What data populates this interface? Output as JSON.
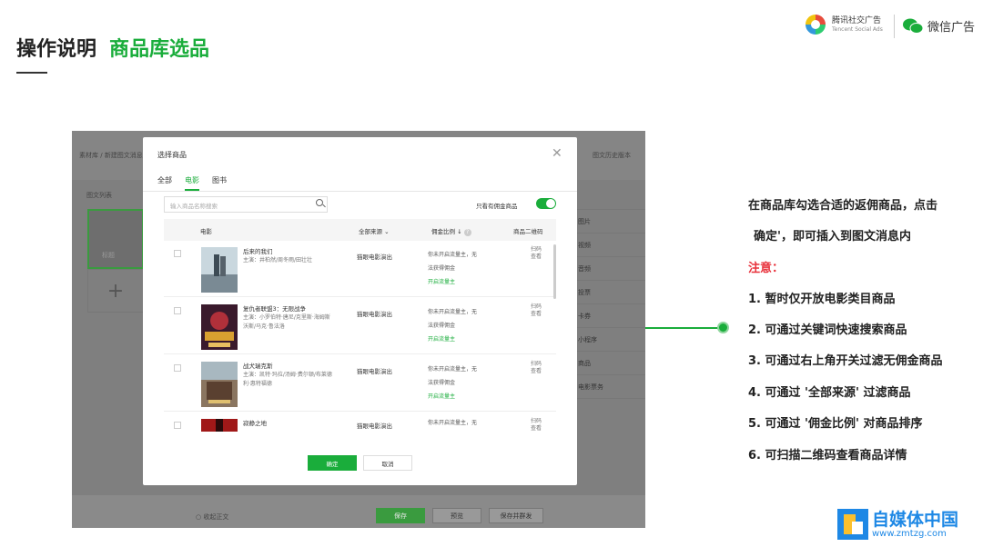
{
  "header": {
    "title": "操作说明",
    "subtitle": "商品库选品"
  },
  "logos": {
    "tencent_cn": "腾讯社交广告",
    "tencent_en": "Tencent Social Ads",
    "wechat": "微信广告"
  },
  "bg_screen": {
    "breadcrumb1": "素材库",
    "breadcrumb2": "新建图文消息",
    "history": "图文历史版本",
    "list_label": "图文列表",
    "card_label": "标题",
    "side_items": [
      "图片",
      "视频",
      "音频",
      "投票",
      "卡券",
      "小程序",
      "商品",
      "电影票务"
    ],
    "collapse": "收起正文",
    "btn_save": "保存",
    "btn_preview": "预览",
    "btn_save_send": "保存并群发"
  },
  "modal": {
    "title": "选择商品",
    "tabs": [
      "全部",
      "电影",
      "图书"
    ],
    "search_placeholder": "输入商品名称搜索",
    "filter_label": "只看有佣金商品",
    "columns": {
      "movie": "电影",
      "source": "全部来源",
      "commission": "佣金比例",
      "qr": "商品二维码"
    },
    "rows": [
      {
        "name": "后来的我们",
        "cast": "主演：井柏然/周冬雨/田壮壮",
        "source": "猫眼电影演出",
        "comm1": "你未开启流量主，无",
        "comm2": "法获得佣金",
        "comm_link": "开启流量主",
        "qr": "扫码 查看"
      },
      {
        "name": "复仇者联盟3：无限战争",
        "cast": "主演：小罗伯特·唐尼/克里斯·海姆斯沃斯/马克·鲁法洛",
        "source": "猫眼电影演出",
        "comm1": "你未开启流量主，无",
        "comm2": "法获得佣金",
        "comm_link": "开启流量主",
        "qr": "扫码 查看"
      },
      {
        "name": "战犬瑞克斯",
        "cast": "主演：凯特·玛拉/汤姆·费尔顿/布莱德利·惠特福德",
        "source": "猫眼电影演出",
        "comm1": "你未开启流量主，无",
        "comm2": "法获得佣金",
        "comm_link": "开启流量主",
        "qr": "扫码 查看"
      },
      {
        "name": "寂静之地",
        "cast": "",
        "source": "猫眼电影演出",
        "comm1": "你未开启流量主，无",
        "comm2": "",
        "comm_link": "",
        "qr": "扫码 查看"
      }
    ],
    "ok": "确定",
    "cancel": "取消"
  },
  "instructions": {
    "line1": "在商品库勾选合适的返佣商品，点击",
    "line2": "确定'，即可插入到图文消息内",
    "note": "注意：",
    "items": [
      "1.  暂时仅开放电影类目商品",
      "2.  可通过关键词快速搜索商品",
      "3.  可通过右上角开关过滤无佣金商品",
      "4.  可通过 '全部来源' 过滤商品",
      "5.  可通过 '佣金比例' 对商品排序",
      "6.  可扫描二维码查看商品详情"
    ]
  },
  "watermark": {
    "cn": "自媒体中国",
    "url": "www.zmtzg.com"
  },
  "colors": {
    "accent": "#1aad3b",
    "note_red": "#e8323c"
  }
}
